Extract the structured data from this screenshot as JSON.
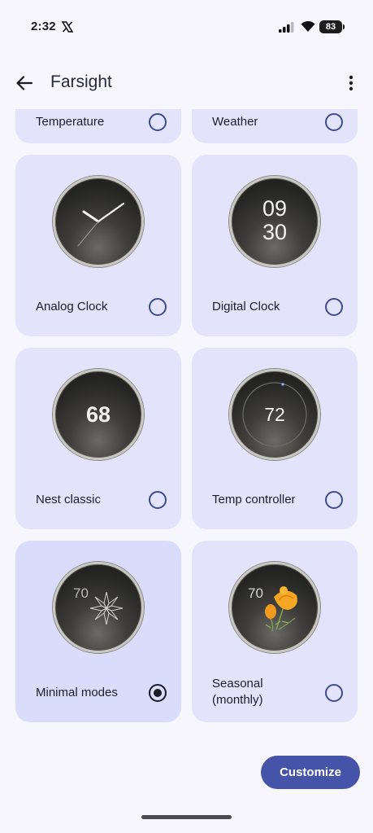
{
  "status_bar": {
    "time": "2:32",
    "battery": "83"
  },
  "app_bar": {
    "title": "Farsight"
  },
  "cards": {
    "temperature": {
      "label": "Temperature",
      "selected": false
    },
    "weather": {
      "label": "Weather",
      "selected": false
    },
    "analog_clock": {
      "label": "Analog Clock",
      "selected": false
    },
    "digital_clock": {
      "label": "Digital Clock",
      "selected": false,
      "hour": "09",
      "minute": "30"
    },
    "nest_classic": {
      "label": "Nest classic",
      "selected": false,
      "value": "68"
    },
    "temp_controller": {
      "label": "Temp controller",
      "selected": false,
      "value": "72"
    },
    "minimal_modes": {
      "label": "Minimal modes",
      "selected": true,
      "value": "70"
    },
    "seasonal": {
      "label": "Seasonal (monthly)",
      "label_line1": "Seasonal",
      "label_line2": "(monthly)",
      "selected": false,
      "value": "70"
    }
  },
  "footer": {
    "customize_label": "Customize"
  },
  "colors": {
    "card_background": "#e3e4fb",
    "card_selected_background": "#d9dcfb",
    "accent": "#4554a8",
    "radio_border": "#3d4c8f",
    "page_background": "#f7f6fd"
  }
}
